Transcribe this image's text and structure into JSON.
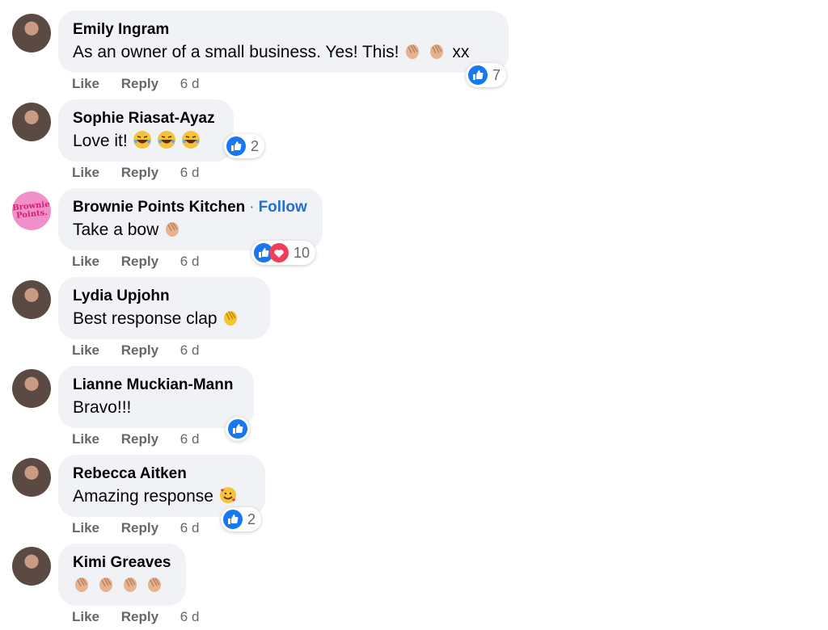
{
  "comments": [
    {
      "author": "Emily Ingram",
      "text": "As an owner of a small business. Yes! This!",
      "text_suffix": "xx",
      "emojis": [
        "clapping-hands",
        "clapping-hands"
      ],
      "reaction_types": [
        "like"
      ],
      "reaction_count": "7",
      "actions": {
        "like": "Like",
        "reply": "Reply",
        "time": "6 d"
      }
    },
    {
      "author": "Sophie Riasat-Ayaz",
      "text": "Love it!",
      "emojis": [
        "tears-of-joy",
        "tears-of-joy",
        "tears-of-joy"
      ],
      "reaction_types": [
        "like"
      ],
      "reaction_count": "2",
      "actions": {
        "like": "Like",
        "reply": "Reply",
        "time": "6 d"
      }
    },
    {
      "author": "Brownie Points Kitchen",
      "follow_label": "Follow",
      "avatar_text": "Brownie Points.",
      "text": "Take a bow",
      "emojis": [
        "clapping-hands"
      ],
      "reaction_types": [
        "like",
        "love"
      ],
      "reaction_count": "10",
      "actions": {
        "like": "Like",
        "reply": "Reply",
        "time": "6 d"
      }
    },
    {
      "author": "Lydia Upjohn",
      "text": "Best response clap",
      "emojis": [
        "clapping-hands"
      ],
      "actions": {
        "like": "Like",
        "reply": "Reply",
        "time": "6 d"
      }
    },
    {
      "author": "Lianne Muckian-Mann",
      "text": "Bravo!!!",
      "reaction_types": [
        "like"
      ],
      "actions": {
        "like": "Like",
        "reply": "Reply",
        "time": "6 d"
      }
    },
    {
      "author": "Rebecca Aitken",
      "text": "Amazing response",
      "emojis": [
        "smiling-face-with-hearts"
      ],
      "reaction_types": [
        "like"
      ],
      "reaction_count": "2",
      "actions": {
        "like": "Like",
        "reply": "Reply",
        "time": "6 d"
      }
    },
    {
      "author": "Kimi Greaves",
      "text": "",
      "emojis": [
        "clapping-hands",
        "clapping-hands",
        "clapping-hands",
        "clapping-hands"
      ],
      "actions": {
        "like": "Like",
        "reply": "Reply",
        "time": "6 d"
      }
    }
  ],
  "colors": {
    "like_blue": "#1877f2",
    "love_red": "#f33e58",
    "follow_blue": "#216fdb",
    "bubble_gray": "#f0f2f5",
    "meta_gray": "#65676b"
  }
}
